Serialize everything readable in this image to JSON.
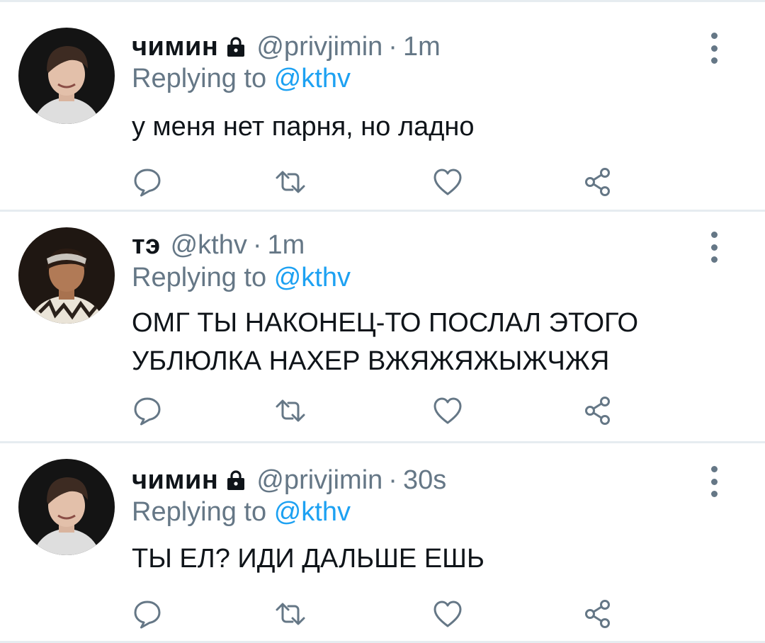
{
  "colors": {
    "text": "#0f1419",
    "secondary": "#657786",
    "link": "#1da1f2",
    "divider": "#e6ecf0"
  },
  "icons": {
    "protected": "lock-icon",
    "more": "more-vertical-icon",
    "reply": "reply-icon",
    "retweet": "retweet-icon",
    "like": "heart-icon",
    "share": "share-icon"
  },
  "tweets": [
    {
      "name": "чимин",
      "protected": true,
      "handle": "@privjimin",
      "sep": "·",
      "time": "1m",
      "reply_prefix": "Replying to",
      "reply_to": "@kthv",
      "text": "у меня нет парня, но ладно"
    },
    {
      "name": "тэ",
      "protected": false,
      "handle": "@kthv",
      "sep": "·",
      "time": "1m",
      "reply_prefix": "Replying to",
      "reply_to": "@kthv",
      "text": "ОМГ ТЫ НАКОНЕЦ-ТО ПОСЛАЛ ЭТОГО УБЛЮЛКА НАХЕР ВЖЯЖЯЖЫЖЧЖЯ"
    },
    {
      "name": "чимин",
      "protected": true,
      "handle": "@privjimin",
      "sep": "·",
      "time": "30s",
      "reply_prefix": "Replying to",
      "reply_to": "@kthv",
      "text": "ТЫ ЕЛ? ИДИ ДАЛЬШЕ ЕШЬ"
    }
  ]
}
